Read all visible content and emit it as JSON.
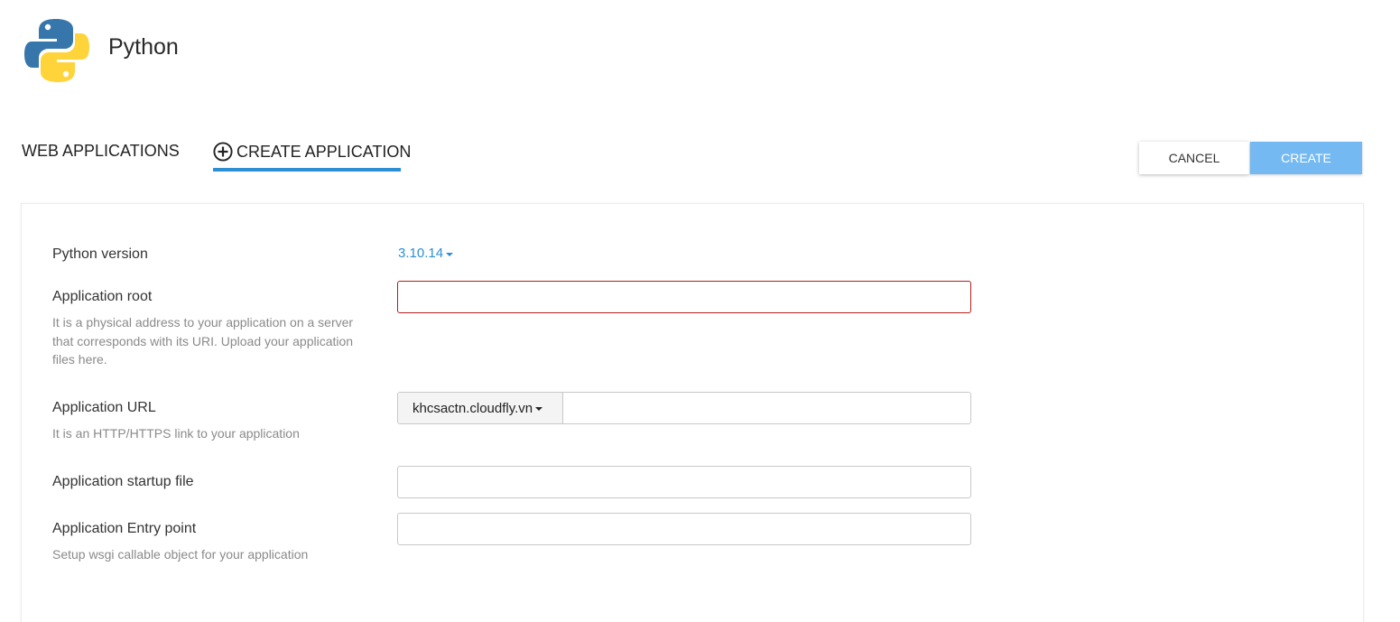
{
  "header": {
    "title": "Python",
    "logo_icon": "python-logo-icon"
  },
  "tabs": [
    {
      "label": "WEB APPLICATIONS",
      "active": false
    },
    {
      "label": "CREATE APPLICATION",
      "active": true,
      "icon": "plus-circle-icon"
    }
  ],
  "toolbar": {
    "cancel_label": "CANCEL",
    "create_label": "CREATE"
  },
  "colors": {
    "accent": "#2d8ed6",
    "create_button": "#74b9f1",
    "error_border": "#b41b1b"
  },
  "form": {
    "python_version": {
      "label": "Python version",
      "value": "3.10.14"
    },
    "app_root": {
      "label": "Application root",
      "help": "It is a physical address to your application on a server that corresponds with its URI. Upload your application files here.",
      "value": ""
    },
    "app_url": {
      "label": "Application URL",
      "help": "It is an HTTP/HTTPS link to your application",
      "domain": "khcsactn.cloudfly.vn",
      "value": ""
    },
    "startup_file": {
      "label": "Application startup file",
      "value": ""
    },
    "entry_point": {
      "label": "Application Entry point",
      "help": "Setup wsgi callable object for your application",
      "value": ""
    }
  }
}
